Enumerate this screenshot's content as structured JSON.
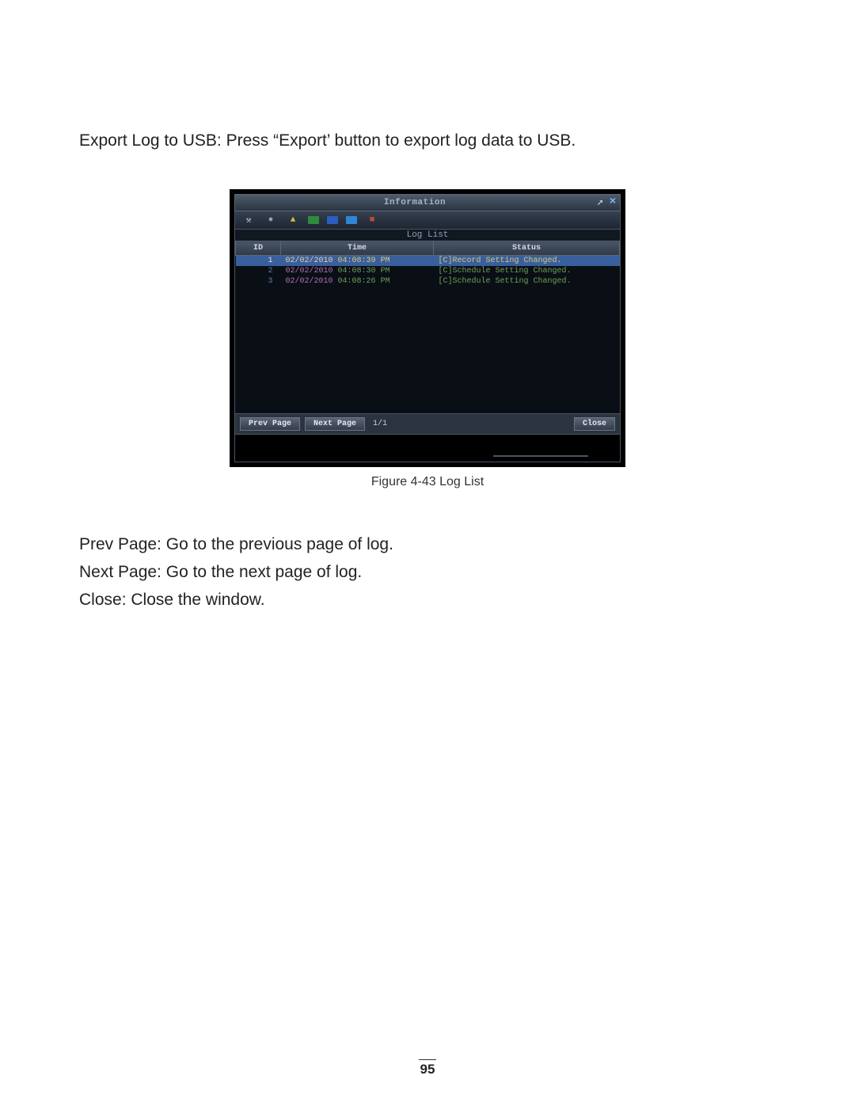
{
  "intro": {
    "label": "Export Log to USB:",
    "text": " Press “Export’ button to export log data to USB."
  },
  "window": {
    "title": "Information",
    "subtitle": "Log List",
    "columns": {
      "id": "ID",
      "time": "Time",
      "status": "Status"
    },
    "rows": [
      {
        "id": "1",
        "date": "02/02/2010",
        "time": "04:08:39",
        "ampm": "PM",
        "status": "[C]Record Setting Changed.",
        "selected": true
      },
      {
        "id": "2",
        "date": "02/02/2010",
        "time": "04:08:30",
        "ampm": "PM",
        "status": "[C]Schedule Setting Changed.",
        "selected": false
      },
      {
        "id": "3",
        "date": "02/02/2010",
        "time": "04:08:26",
        "ampm": "PM",
        "status": "[C]Schedule Setting Changed.",
        "selected": false
      }
    ],
    "footer": {
      "prev": "Prev Page",
      "next": "Next Page",
      "page": "1/1",
      "close": "Close"
    }
  },
  "caption": "Figure 4-43 Log List",
  "definitions": [
    {
      "label": "Prev Page:",
      "text": " Go to the previous page of log."
    },
    {
      "label": "Next Page:",
      "text": " Go to the next page of log."
    },
    {
      "label": "Close:",
      "text": " Close the window."
    }
  ],
  "pagenum": "95"
}
